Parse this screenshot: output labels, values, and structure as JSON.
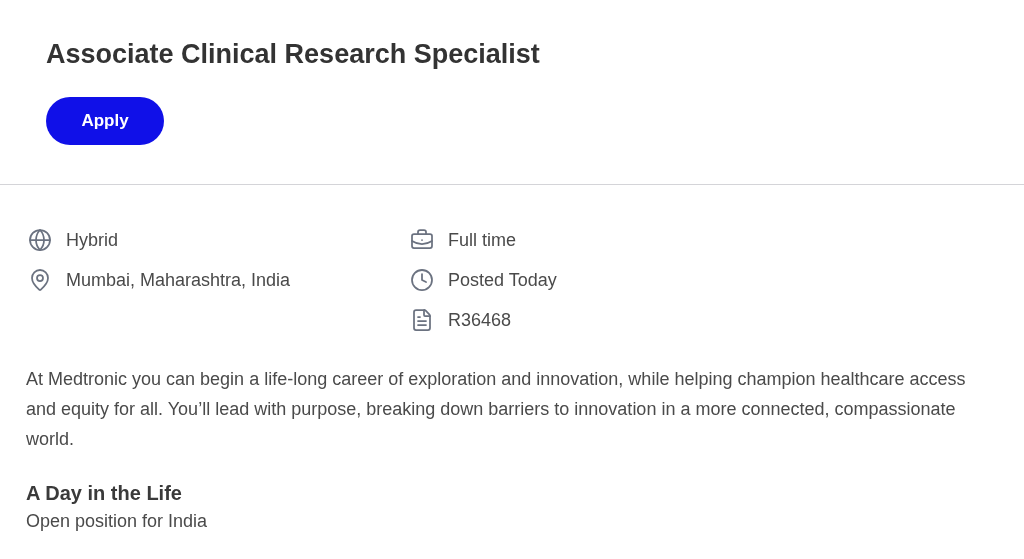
{
  "job_title": "Associate Clinical Research Specialist",
  "apply_button": "Apply",
  "details_left": [
    {
      "kind": "globe",
      "text": "Hybrid"
    },
    {
      "kind": "pin",
      "text": "Mumbai, Maharashtra, India"
    }
  ],
  "details_right": [
    {
      "kind": "briefcase",
      "text": "Full time"
    },
    {
      "kind": "clock",
      "text": "Posted Today"
    },
    {
      "kind": "document",
      "text": "R36468"
    }
  ],
  "intro": "At Medtronic you can begin a life-long career of exploration and innovation, while helping champion healthcare access and equity for all. You’ll lead with purpose, breaking down barriers to innovation in a more connected, compassionate world.",
  "section": {
    "heading": "A Day in the Life",
    "text": "Open position for India"
  }
}
